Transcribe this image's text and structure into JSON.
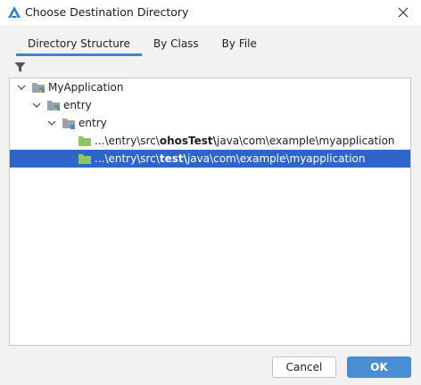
{
  "window": {
    "title": "Choose Destination Directory",
    "logo_icon": "harmony-app-icon",
    "close_icon": "close-icon"
  },
  "tabs": [
    {
      "label": "Directory Structure",
      "active": true
    },
    {
      "label": "By Class",
      "active": false
    },
    {
      "label": "By File",
      "active": false
    }
  ],
  "filter_icon": "filter-icon",
  "tree": {
    "root": {
      "label": "MyApplication",
      "expanded": true
    },
    "module": {
      "label": "entry",
      "expanded": true
    },
    "source_set": {
      "label": "entry",
      "expanded": true
    },
    "items": [
      {
        "prefix": "...\\entry\\src\\",
        "bold": "ohosTest\\",
        "suffix": "java\\com\\example\\myapplication",
        "selected": false
      },
      {
        "prefix": "...\\entry\\src\\",
        "bold": "test\\",
        "suffix": "java\\com\\example\\myapplication",
        "selected": true
      }
    ]
  },
  "buttons": {
    "cancel": "Cancel",
    "ok": "OK"
  },
  "colors": {
    "accent": "#3b86c9",
    "selection": "#2f65ca",
    "ok_button": "#4a8fd6",
    "folder": "#8fc56a"
  }
}
